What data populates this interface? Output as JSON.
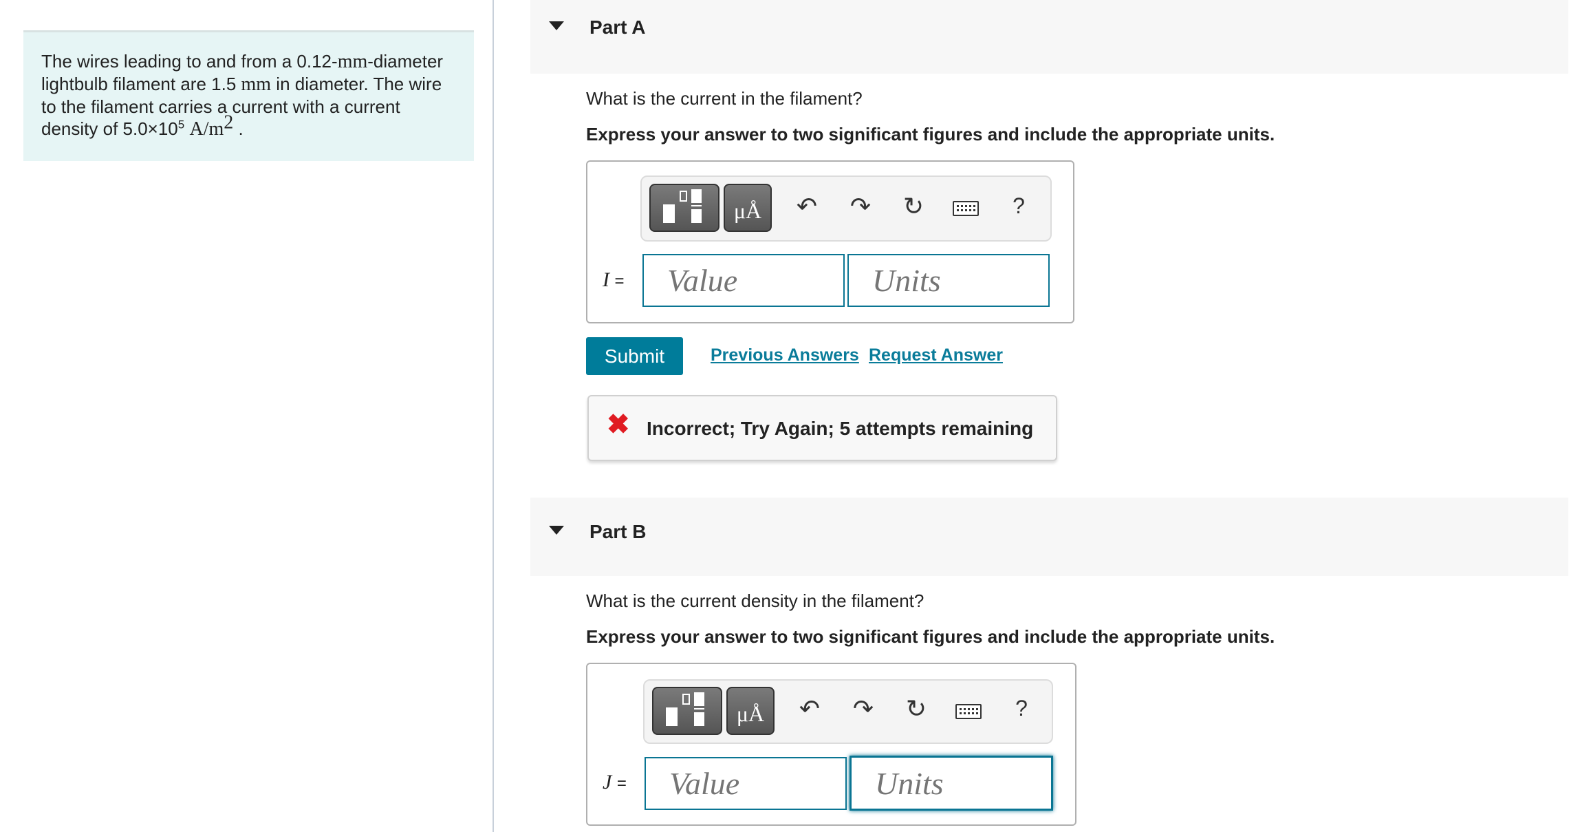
{
  "problem": {
    "line1_pre": "The wires leading to and from a 0.12-",
    "line1_unit": "mm",
    "line1_post": "-diameter",
    "line2_pre": "lightbulb filament are 1.5 ",
    "line2_unit": "mm",
    "line2_post": " in diameter. The wire",
    "line3": "to the filament carries a current with a current",
    "line4_pre": "density of 5.0×10",
    "line4_exp": "5",
    "line4_unit": "A/m",
    "line4_unit_exp": "2",
    "line4_post": " ."
  },
  "parts": [
    {
      "title": "Part A",
      "question": "What is the current in the filament?",
      "instruction": "Express your answer to two significant figures and include the appropriate units.",
      "variable": "I",
      "equals": "=",
      "value_placeholder": "Value",
      "units_placeholder": "Units",
      "submit_label": "Submit",
      "previous_answers_label": "Previous Answers",
      "request_answer_label": "Request Answer",
      "feedback": "Incorrect; Try Again; 5 attempts remaining"
    },
    {
      "title": "Part B",
      "question": "What is the current density in the filament?",
      "instruction": "Express your answer to two significant figures and include the appropriate units.",
      "variable": "J",
      "equals": "=",
      "value_placeholder": "Value",
      "units_placeholder": "Units"
    }
  ],
  "toolbar": {
    "units_button": "μÅ",
    "help": "?"
  },
  "colors": {
    "accent": "#007c9a",
    "error": "#e01b22",
    "problem_bg": "#e6f5f5",
    "header_bg": "#f7f7f7"
  }
}
